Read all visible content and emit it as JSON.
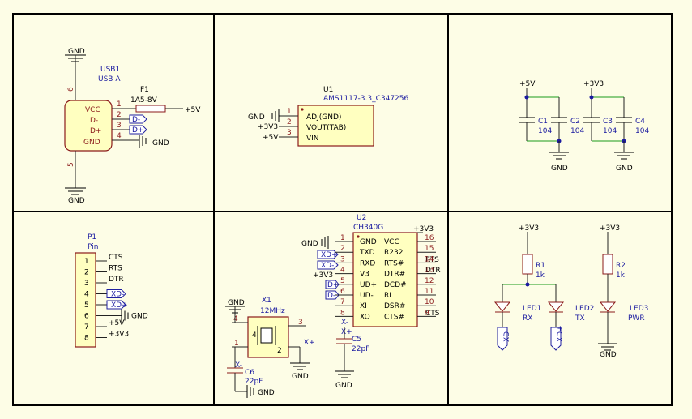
{
  "usb": {
    "ref": "USB1",
    "val": "USB A",
    "p6": "6",
    "p5": "5",
    "vcc": "VCC",
    "dm": "D-",
    "dp": "D+",
    "gnd": "GND",
    "n1": "1",
    "n2": "2",
    "n3": "3",
    "n4": "4",
    "gnd_top": "GND",
    "gnd_bot": "GND",
    "gnd_pin": "GND"
  },
  "fuse": {
    "ref": "F1",
    "val": "1A5-8V",
    "net": "+5V"
  },
  "usb_ports": {
    "dm": "D-",
    "dp": "D+"
  },
  "u1": {
    "ref": "U1",
    "val": "AMS1117-3.3_C347256",
    "adj": "ADJ(GND)",
    "vout": "VOUT(TAB)",
    "vin": "VIN",
    "n1": "1",
    "n2": "2",
    "n3": "3",
    "net1": "GND",
    "net2": "+3V3",
    "net3": "+5V"
  },
  "caps_pwr": {
    "v5": "+5V",
    "v33": "+3V3",
    "c1": "C1",
    "c2": "C2",
    "c3": "C3",
    "c4": "C4",
    "val": "104",
    "gnd1": "GND",
    "gnd2": "GND"
  },
  "p1": {
    "ref": "P1",
    "val": "Pin",
    "pins": [
      "1",
      "2",
      "3",
      "4",
      "5",
      "6",
      "7",
      "8"
    ],
    "nets": [
      "CTS",
      "RTS",
      "DTR",
      "XD-",
      "XD+",
      "GND",
      "+5V",
      "+3V3"
    ]
  },
  "u2": {
    "ref": "U2",
    "val": "CH340G",
    "left": [
      "GND",
      "TXD",
      "RXD",
      "V3",
      "UD+",
      "UD-",
      "XI",
      "XO"
    ],
    "right": [
      "VCC",
      "R232",
      "RTS#",
      "DTR#",
      "DCD#",
      "RI",
      "DSR#",
      "CTS#"
    ],
    "lnums": [
      "1",
      "2",
      "3",
      "4",
      "5",
      "6",
      "7",
      "8"
    ],
    "rnums": [
      "16",
      "15",
      "14",
      "13",
      "12",
      "11",
      "10",
      "9"
    ],
    "gnd": "GND",
    "v33": "+3V3",
    "v33b": "+3V3",
    "rts": "RTS",
    "dtr": "DTR",
    "cts": "CTS",
    "xdp": "XD+",
    "xdm": "XD-",
    "dp": "D+",
    "dm": "D-",
    "xm": "X-",
    "xp": "X+"
  },
  "x1": {
    "ref": "X1",
    "val": "12MHz",
    "p1": "1",
    "p2": "2",
    "p3": "3",
    "p4": "4",
    "gnd1": "GND",
    "gnd2": "GND",
    "xm": "X-",
    "xp": "X+"
  },
  "c5": {
    "ref": "C5",
    "val": "22pF",
    "gnd": "GND"
  },
  "c6": {
    "ref": "C6",
    "val": "22pF",
    "gnd": "GND"
  },
  "leds": {
    "v33a": "+3V3",
    "v33b": "+3V3",
    "r1": "R1",
    "r2": "R2",
    "rval": "1k",
    "led1": "LED1",
    "led2": "LED2",
    "led3": "LED3",
    "rx": "RX",
    "tx": "TX",
    "pwr": "PWR",
    "xdm": "XD-",
    "xdp": "XD+",
    "gnd": "GND"
  }
}
